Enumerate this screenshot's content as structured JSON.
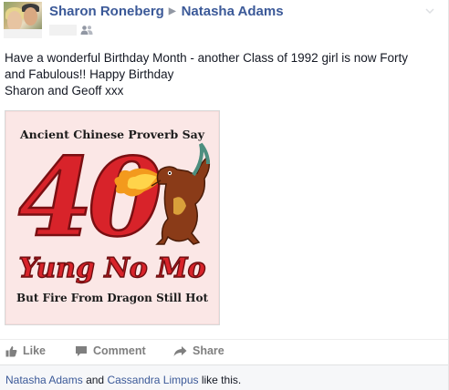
{
  "post": {
    "author": "Sharon Roneberg",
    "recipient": "Natasha Adams",
    "message_line1": "Have a wonderful Birthday Month - another Class of 1992 girl is now Forty",
    "message_line2": "and Fabulous!! Happy Birthday",
    "message_line3": "Sharon and Geoff xxx"
  },
  "photo": {
    "top_text": "Ancient Chinese Proverb Say",
    "big_number": "40",
    "middle_text": "Yung No Mo",
    "bottom_text": "But Fire From Dragon Still Hot"
  },
  "actions": {
    "like": "Like",
    "comment": "Comment",
    "share": "Share"
  },
  "likes": {
    "person1": "Natasha Adams",
    "connector": "and",
    "person2": "Cassandra Limpus",
    "suffix": "like this."
  },
  "icons": {
    "avatar": "profile-photo",
    "separator": "triangle-right-icon",
    "audience": "friends-icon",
    "menu": "chevron-down-icon",
    "like": "thumbs-up-icon",
    "comment": "speech-bubble-icon",
    "share": "share-arrow-icon"
  },
  "colors": {
    "link": "#3b5998",
    "text": "#141823",
    "muted": "#7f7f7f",
    "photo_red": "#d8232a",
    "photo_bg": "#fbe7e6"
  }
}
